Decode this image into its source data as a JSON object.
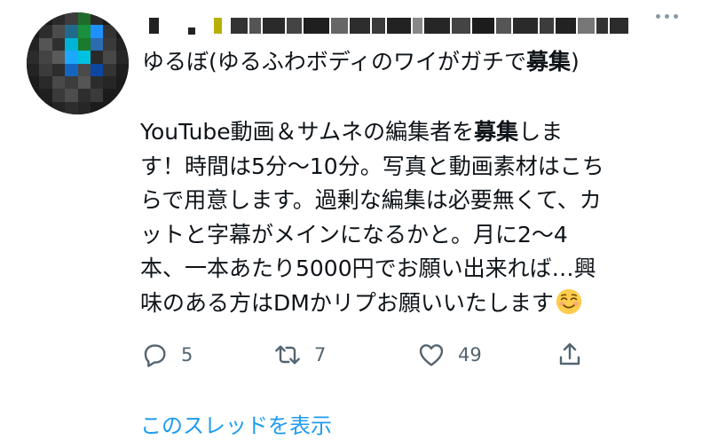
{
  "tweet": {
    "display_name_regular": "ゆるぼ(ゆるふわボディのワイがガチで",
    "display_name_bold": "募集",
    "display_name_close": ")",
    "text_lines": [
      {
        "pre": "YouTube動画＆サムネの編集者を",
        "bold": "募集",
        "post": "しま"
      },
      {
        "text": "す！時間は5分〜10分。写真と動画素材はこち"
      },
      {
        "text": "らで用意します。過剰な編集は必要無くて、カ"
      },
      {
        "text": "ットと字幕がメインになるかと。月に2〜4"
      },
      {
        "text": "本、一本あたり5000円でお願い出来れば…興"
      },
      {
        "text": "味のある方はDMかリプお願いいたします"
      }
    ],
    "emoji": "smiling-face-emoji"
  },
  "actions": {
    "reply_count": "5",
    "retweet_count": "7",
    "like_count": "49"
  },
  "icons": {
    "reply": "reply-icon",
    "retweet": "retweet-icon",
    "like": "heart-icon",
    "share": "share-icon",
    "more": "more-icon"
  },
  "thread_link": "このスレッドを表示",
  "colors": {
    "text": "#0f1419",
    "icon": "#536471",
    "link": "#1d9bf0"
  }
}
